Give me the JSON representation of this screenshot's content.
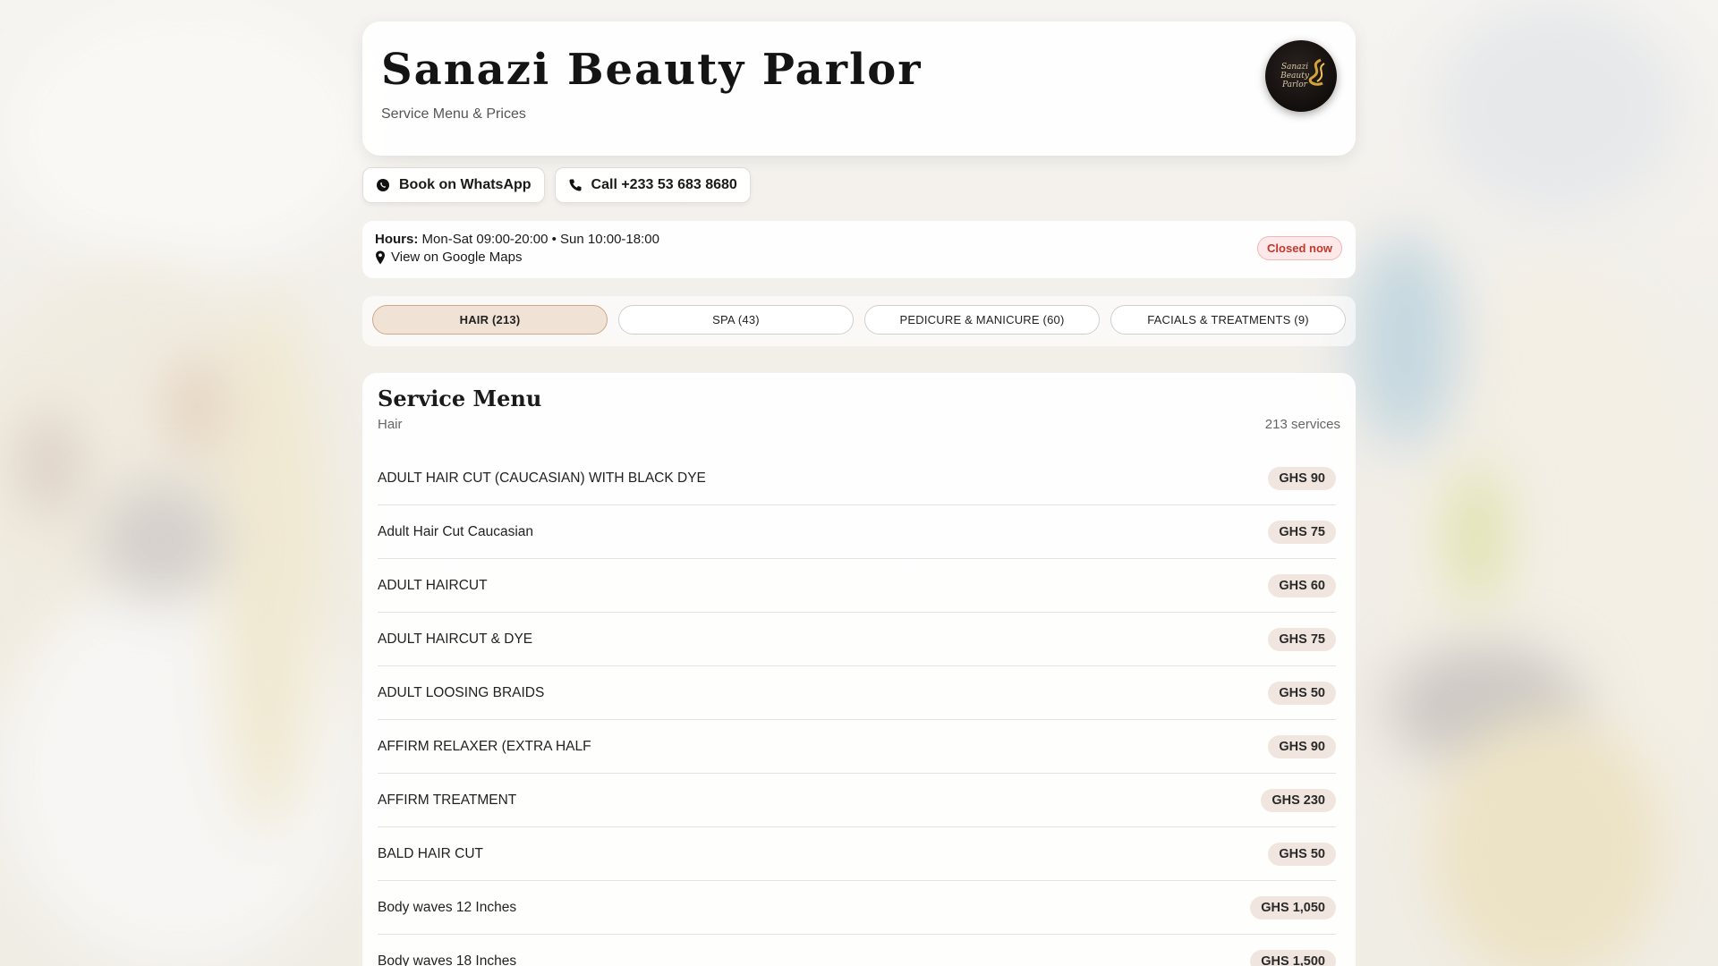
{
  "header": {
    "title": "Sanazi Beauty Parlor",
    "subtitle": "Service Menu & Prices",
    "logo_lines": [
      "Sanazi",
      "Beauty",
      "Parlor"
    ]
  },
  "actions": {
    "whatsapp_label": "Book on WhatsApp",
    "call_label": "Call +233 53 683 8680"
  },
  "info": {
    "hours_label": "Hours:",
    "hours_value": "Mon-Sat 09:00-20:00 • Sun 10:00-18:00",
    "maps_label": "View on Google Maps",
    "status": "Closed now"
  },
  "tabs": [
    {
      "label": "HAIR (213)",
      "active": true
    },
    {
      "label": "SPA (43)",
      "active": false
    },
    {
      "label": "PEDICURE & MANICURE (60)",
      "active": false
    },
    {
      "label": "FACIALS & TREATMENTS (9)",
      "active": false
    }
  ],
  "menu": {
    "title": "Service Menu",
    "category": "Hair",
    "count": "213 services",
    "items": [
      {
        "name": "ADULT HAIR CUT (CAUCASIAN) WITH BLACK DYE",
        "price": "GHS 90"
      },
      {
        "name": "Adult Hair Cut Caucasian",
        "price": "GHS 75"
      },
      {
        "name": "ADULT HAIRCUT",
        "price": "GHS 60"
      },
      {
        "name": "ADULT HAIRCUT & DYE",
        "price": "GHS 75"
      },
      {
        "name": "ADULT LOOSING BRAIDS",
        "price": "GHS 50"
      },
      {
        "name": "AFFIRM RELAXER (EXTRA HALF",
        "price": "GHS 90"
      },
      {
        "name": "AFFIRM TREATMENT",
        "price": "GHS 230"
      },
      {
        "name": "BALD HAIR CUT",
        "price": "GHS 50"
      },
      {
        "name": "Body waves 12 Inches",
        "price": "GHS 1,050"
      },
      {
        "name": "Body waves 18 Inches",
        "price": "GHS 1,500"
      }
    ]
  },
  "colors": {
    "accent_tab": "#f1e2d6",
    "status_red": "#c0392b",
    "price_pill": "#f0e6df"
  }
}
